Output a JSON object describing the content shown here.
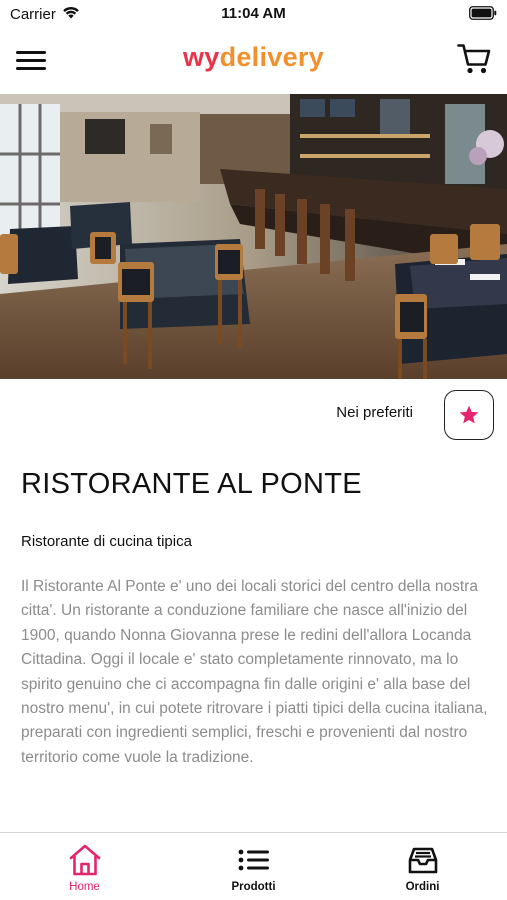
{
  "status_bar": {
    "carrier": "Carrier",
    "time": "11:04 AM"
  },
  "header": {
    "brand_part1": "wy",
    "brand_part2": "delivery",
    "brand_color_1": "#e8344b",
    "brand_color_2": "#f2912c",
    "menu_icon": "hamburger-icon",
    "cart_icon": "cart-icon"
  },
  "hero": {
    "image": "restaurant interior photo"
  },
  "favorite": {
    "label": "Nei preferiti",
    "icon": "star-icon",
    "accent": "#e6246e"
  },
  "restaurant": {
    "name": "RISTORANTE AL PONTE",
    "subtitle": "Ristorante di cucina tipica",
    "description": "Il Ristorante Al Ponte e' uno dei locali storici del centro della nostra citta'. Un ristorante a conduzione familiare che nasce all'inizio del 1900, quando Nonna Giovanna prese le redini dell'allora Locanda Cittadina. Oggi il locale e' stato completamente rinnovato, ma lo spirito genuino che ci accompagna fin dalle origini e' alla base del nostro menu', in cui potete ritrovare i piatti tipici della cucina italiana, preparati con ingredienti semplici, freschi e provenienti dal nostro territorio come vuole la tradizione."
  },
  "tabs": [
    {
      "label": "Home",
      "icon": "home-icon",
      "active": true
    },
    {
      "label": "Prodotti",
      "icon": "list-icon",
      "active": false
    },
    {
      "label": "Ordini",
      "icon": "inbox-icon",
      "active": false
    }
  ]
}
